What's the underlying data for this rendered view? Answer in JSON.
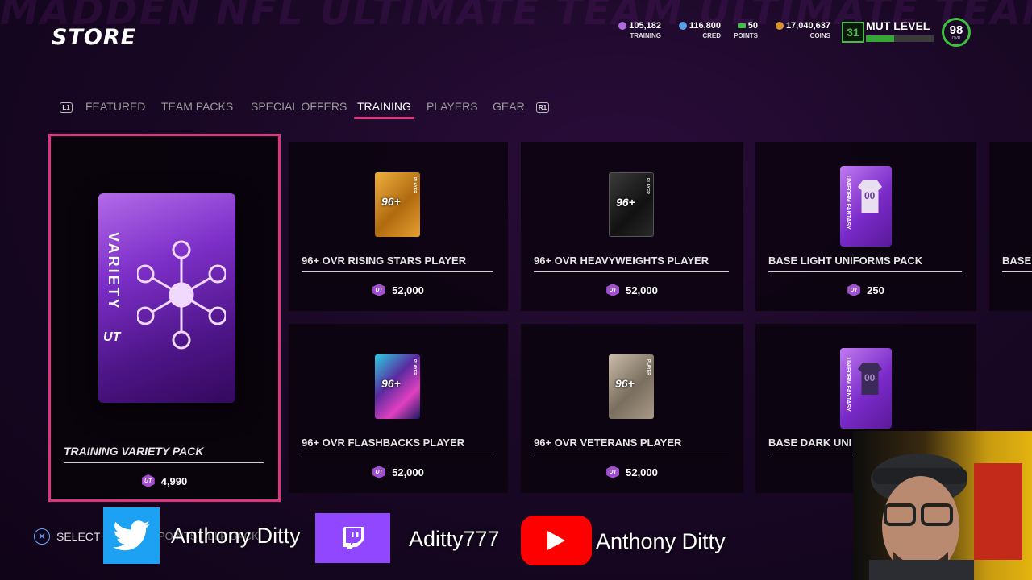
{
  "header": {
    "title": "STORE",
    "background_text": "MADDEN NFL ULTIMATE TEAM ULTIMATE TEAM ULTIMATE"
  },
  "currencies": [
    {
      "value": "105,182",
      "label": "TRAINING",
      "icon": "training-icon",
      "color": "#b06ae0"
    },
    {
      "value": "116,800",
      "label": "CRED",
      "icon": "cred-icon",
      "color": "#5aa0e6"
    },
    {
      "value": "50",
      "label": "POINTS",
      "icon": "points-icon",
      "color": "#3fbf3f"
    },
    {
      "value": "17,040,637",
      "label": "COINS",
      "icon": "coins-icon",
      "color": "#d8952e"
    }
  ],
  "mut": {
    "level": "31",
    "label": "MUT LEVEL",
    "progress": 0.42,
    "ovr": "98",
    "ovr_label": "OVR"
  },
  "tabs": {
    "left_bumper": "L1",
    "right_bumper": "R1",
    "items": [
      {
        "label": "FEATURED",
        "active": false
      },
      {
        "label": "TEAM PACKS",
        "active": false
      },
      {
        "label": "SPECIAL OFFERS",
        "active": false
      },
      {
        "label": "TRAINING",
        "active": true
      },
      {
        "label": "PLAYERS",
        "active": false
      },
      {
        "label": "GEAR",
        "active": false
      }
    ]
  },
  "featured": {
    "name": "TRAINING VARIETY PACK",
    "price": "4,990",
    "pack_text": "VARIETY",
    "pack_logo": "UT"
  },
  "cards": [
    {
      "name": "96+ OVR RISING STARS PLAYER",
      "price": "52,000",
      "ovr": "96+",
      "side": "PLAYER"
    },
    {
      "name": "96+ OVR HEAVYWEIGHTS PLAYER",
      "price": "52,000",
      "ovr": "96+",
      "side": "PLAYER"
    },
    {
      "name": "BASE LIGHT UNIFORMS PACK",
      "price": "250",
      "side": "UNIFORM FANTASY",
      "jersey": "00"
    },
    {
      "name": "BASE",
      "price": ""
    },
    {
      "name": "96+ OVR FLASHBACKS PLAYER",
      "price": "52,000",
      "ovr": "96+",
      "side": "PLAYER"
    },
    {
      "name": "96+ OVR VETERANS PLAYER",
      "price": "52,000",
      "ovr": "96+",
      "side": "PLAYER"
    },
    {
      "name": "BASE DARK UNI",
      "price": "",
      "side": "UNIFORM FANTASY",
      "jersey": "00"
    }
  ],
  "currency_logo": "UT",
  "hints": {
    "select": "SELECT",
    "obscured": "POINTS   HELP   BACK"
  },
  "social": {
    "twitter_name": "Anthony Ditty",
    "twitch_name": "Aditty777",
    "youtube_name": "Anthony Ditty"
  }
}
